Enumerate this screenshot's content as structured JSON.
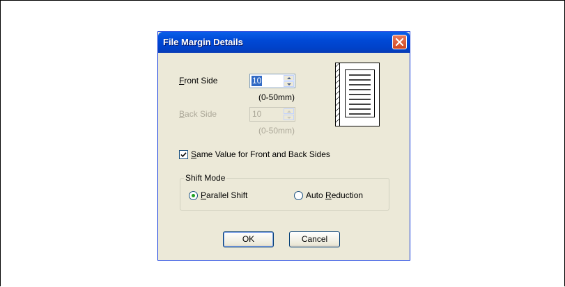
{
  "dialog": {
    "title": "File Margin Details",
    "front_side": {
      "label_first": "F",
      "label_rest": "ront Side",
      "value": "10",
      "range": "(0-50mm)"
    },
    "back_side": {
      "label_first": "B",
      "label_rest": "ack Side",
      "value": "10",
      "range": "(0-50mm)"
    },
    "same_value": {
      "label_first": "S",
      "label_rest": "ame Value for Front and Back Sides",
      "checked": true
    },
    "shift_mode": {
      "label": "Shift Mode",
      "parallel": {
        "label_first": "P",
        "label_rest": "arallel Shift",
        "selected": true
      },
      "auto": {
        "label_pre": "Auto ",
        "label_first": "R",
        "label_rest": "eduction",
        "selected": false
      }
    },
    "ok_label": "OK",
    "cancel_label": "Cancel",
    "icons": {
      "close": "close-icon",
      "preview": "page-preview-icon"
    }
  }
}
